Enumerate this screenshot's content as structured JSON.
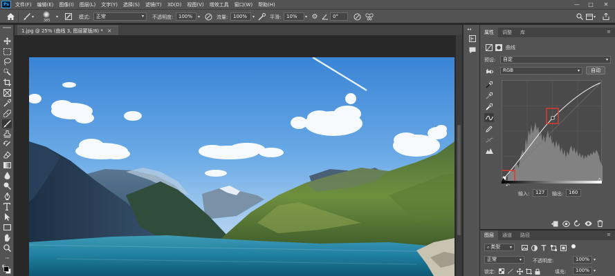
{
  "app": {
    "logo_text": "Ps",
    "menu": [
      "文件(F)",
      "编辑(E)",
      "图像(I)",
      "图层(L)",
      "文字(Y)",
      "选择(S)",
      "滤镜(T)",
      "3D(D)",
      "视图(V)",
      "增效工具",
      "窗口(W)",
      "帮助(H)"
    ],
    "window_controls": [
      "—",
      "□",
      "✕"
    ]
  },
  "options_bar": {
    "brush_size": "385",
    "mode_label": "模式:",
    "mode_value": "正常",
    "opacity_label": "不透明度:",
    "opacity_value": "100%",
    "flow_label": "流量:",
    "flow_value": "100%",
    "smoothing_label": "平滑:",
    "smoothing_value": "10%",
    "angle_value": "0°"
  },
  "document": {
    "tab_title": "1.jpg @ 25% (曲线 3, 图层蒙版/8) *",
    "tab_close": "×"
  },
  "properties": {
    "tabs": [
      "属性",
      "调整",
      "库"
    ],
    "adjustment_title": "曲线",
    "preset_label": "预设:",
    "preset_value": "自定",
    "channel_value": "RGB",
    "auto_button": "自动",
    "input_label": "输入:",
    "input_value": "127",
    "output_label": "输出:",
    "output_value": "160"
  },
  "layers": {
    "tabs": [
      "图层",
      "通道",
      "路径"
    ],
    "filter_value": "类型",
    "blend_mode": "正常",
    "opacity_label": "不透明度:",
    "opacity_value": "100%",
    "lock_label": "锁定:",
    "fill_label": "填充:",
    "fill_value": "100%"
  },
  "colors": {
    "ui_bg": "#535353",
    "canvas_bg": "#282828",
    "highlight_box": "#e03a2e"
  }
}
